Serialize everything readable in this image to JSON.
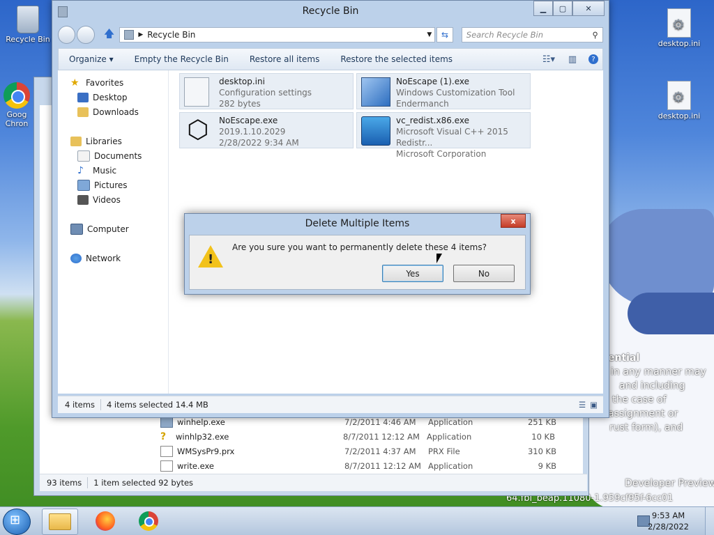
{
  "desktop": {
    "icons": [
      {
        "label": "Recycle Bin"
      },
      {
        "label": "Goog Chron"
      },
      {
        "label": "desktop.ini"
      },
      {
        "label": "desktop.ini"
      }
    ],
    "wallpaper_text": [
      "ential",
      "in any manner may",
      "and including",
      "the case of",
      "assignment or",
      "rust form), and",
      "Developer Preview",
      "64.fbl_beap.11080-1.959cf95f-6cc01"
    ]
  },
  "bg_explorer": {
    "rows": [
      {
        "name": "winhelp.exe",
        "date": "7/2/2011 4:46 AM",
        "type": "Application",
        "size": "251 KB"
      },
      {
        "name": "winhlp32.exe",
        "date": "8/7/2011 12:12 AM",
        "type": "Application",
        "size": "10 KB"
      },
      {
        "name": "WMSysPr9.prx",
        "date": "7/2/2011 4:37 AM",
        "type": "PRX File",
        "size": "310 KB"
      },
      {
        "name": "write.exe",
        "date": "8/7/2011 12:12 AM",
        "type": "Application",
        "size": "9 KB"
      }
    ],
    "status": {
      "count": "93 items",
      "selected": "1 item selected  92 bytes"
    }
  },
  "window": {
    "title": "Recycle Bin",
    "address": "Recycle Bin",
    "search_placeholder": "Search Recycle Bin",
    "toolbar": {
      "organize": "Organize ▾",
      "empty": "Empty the Recycle Bin",
      "restore_all": "Restore all items",
      "restore_selected": "Restore the selected items"
    },
    "nav": {
      "favorites": "Favorites",
      "desktop": "Desktop",
      "downloads": "Downloads",
      "libraries": "Libraries",
      "documents": "Documents",
      "music": "Music",
      "pictures": "Pictures",
      "videos": "Videos",
      "computer": "Computer",
      "network": "Network"
    },
    "files": [
      {
        "name": "desktop.ini",
        "line2": "Configuration settings",
        "line3": "282 bytes"
      },
      {
        "name": "NoEscape (1).exe",
        "line2": "Windows Customization Tool",
        "line3": "Endermanch"
      },
      {
        "name": "NoEscape.exe",
        "line2": "2019.1.10.2029",
        "line3": "2/28/2022 9:34 AM"
      },
      {
        "name": "vc_redist.x86.exe",
        "line2": "Microsoft Visual C++ 2015 Redistr...",
        "line3": "Microsoft Corporation"
      }
    ],
    "status": {
      "count": "4 items",
      "selected": "4 items selected  14.4 MB"
    }
  },
  "dialog": {
    "title": "Delete Multiple Items",
    "message": "Are you sure you want to permanently delete these 4 items?",
    "yes": "Yes",
    "no": "No",
    "close": "x"
  },
  "taskbar": {
    "time": "9:53 AM",
    "date": "2/28/2022"
  }
}
